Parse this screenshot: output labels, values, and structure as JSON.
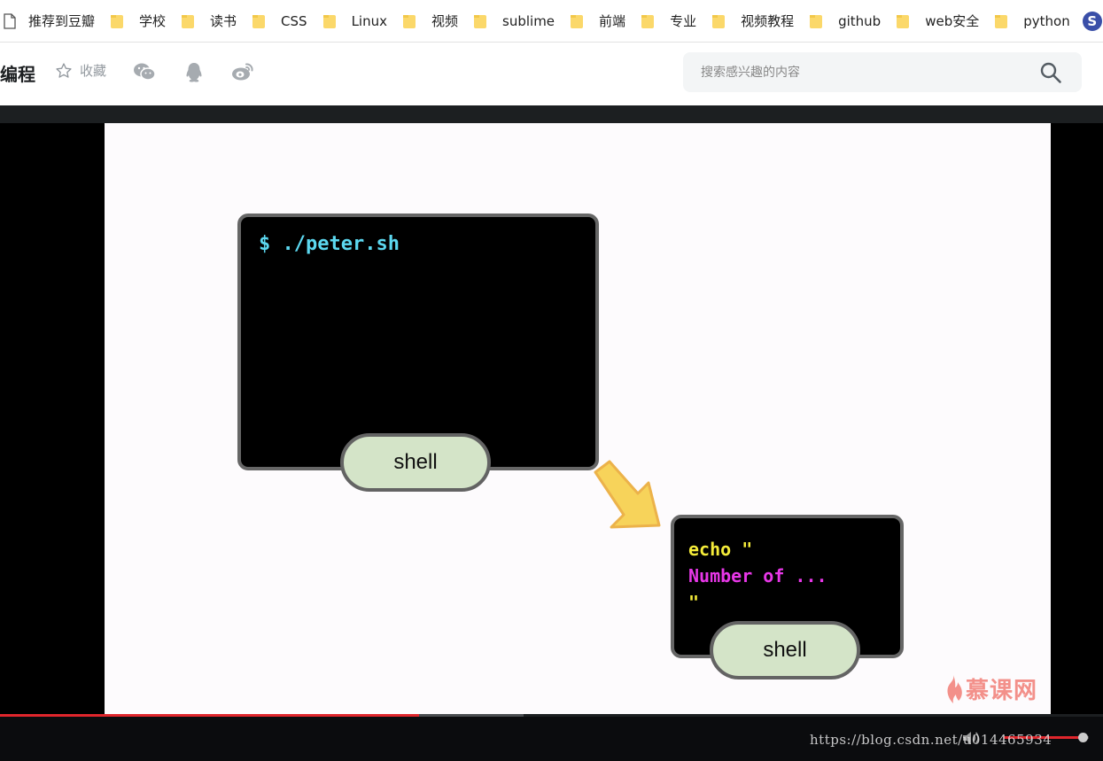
{
  "bookmarks": {
    "items": [
      "推荐到豆瓣",
      "学校",
      "读书",
      "CSS",
      "Linux",
      "视频",
      "sublime",
      "前端",
      "专业",
      "视频教程",
      "github",
      "web安全",
      "python"
    ],
    "extension_glyph": "S"
  },
  "header": {
    "course_title": "编程",
    "favorite_label": "收藏",
    "search_placeholder": "搜索感兴趣的内容"
  },
  "slide": {
    "terminal_1_command": "$ ./peter.sh",
    "terminal_2_line1": "echo \"",
    "terminal_2_line2": "Number of ...",
    "terminal_2_line3": "\"",
    "shell_label_1": "shell",
    "shell_label_2": "shell",
    "logo_text": "慕课网"
  },
  "player": {
    "progress_played_fraction": 0.38,
    "progress_buffered_fraction": 0.475,
    "volume_fraction": 0.93
  },
  "watermark": "https://blog.csdn.net/u014465934",
  "colors": {
    "progress": "#e0262c",
    "cmd_cyan": "#5cd8f0",
    "code_yellow": "#f5ec3a",
    "code_magenta": "#e837e8",
    "pill_green": "#d4e4c8",
    "arrow_yellow": "#f7d35a"
  },
  "icons": [
    "page-icon",
    "folder-icon",
    "sogou-icon",
    "star-icon",
    "wechat-icon",
    "qq-icon",
    "weibo-icon",
    "search-icon",
    "arrow-icon",
    "flame-icon",
    "volume-icon"
  ]
}
